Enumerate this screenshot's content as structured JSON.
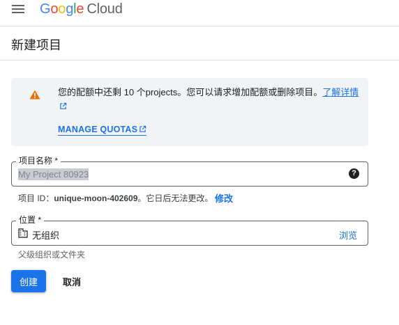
{
  "header": {
    "menu_icon": "hamburger-menu-icon",
    "logo_letters": [
      "G",
      "o",
      "o",
      "g",
      "l",
      "e"
    ],
    "logo_product": "Cloud"
  },
  "page": {
    "title": "新建项目"
  },
  "alert": {
    "icon": "warning-icon",
    "text": "您的配额中还剩 10 个projects。您可以请求增加配额或删除项目。",
    "learn_more": "了解详情",
    "manage_quotas": "MANAGE QUOTAS"
  },
  "project_name": {
    "label": "项目名称 *",
    "value": "My Project 80923",
    "help_icon": "help-icon",
    "help_glyph": "?"
  },
  "project_id": {
    "prefix": "项目 ID：",
    "id": "unique-moon-402609",
    "suffix": "。它日后无法更改。",
    "edit_label": "修改"
  },
  "location": {
    "label": "位置 *",
    "icon": "building-icon",
    "value": "无组织",
    "browse_label": "浏览",
    "hint": "父级组织或文件夹"
  },
  "actions": {
    "create_label": "创建",
    "cancel_label": "取消"
  },
  "colors": {
    "accent": "#1a73e8",
    "warning": "#e37400",
    "alert_bg": "#f1f3f4"
  }
}
